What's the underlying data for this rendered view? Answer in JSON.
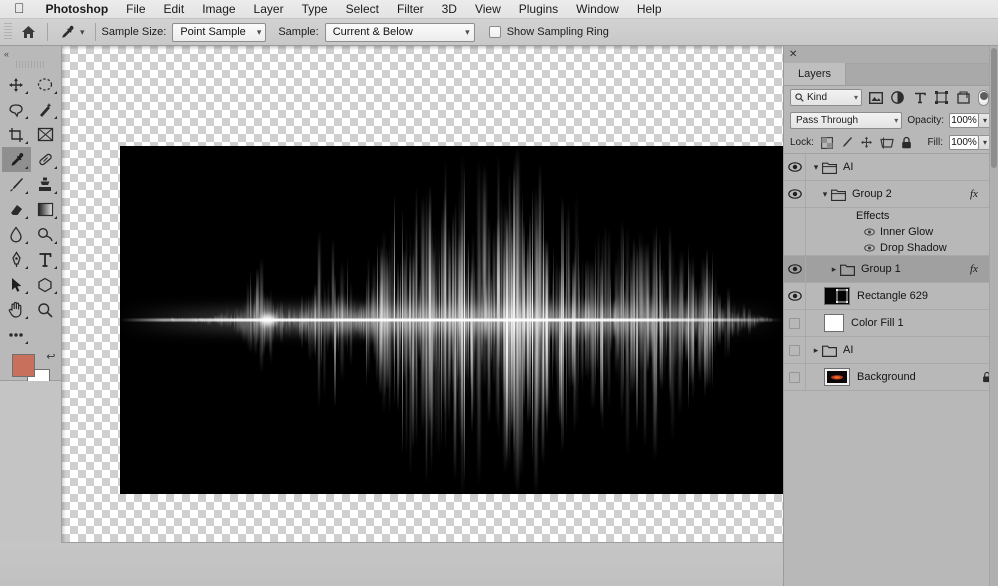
{
  "menubar": {
    "apple_icon": "apple-logo",
    "items": [
      {
        "label": "Photoshop",
        "bold": true
      },
      {
        "label": "File",
        "bold": false
      },
      {
        "label": "Edit",
        "bold": false
      },
      {
        "label": "Image",
        "bold": false
      },
      {
        "label": "Layer",
        "bold": false
      },
      {
        "label": "Type",
        "bold": false
      },
      {
        "label": "Select",
        "bold": false
      },
      {
        "label": "Filter",
        "bold": false
      },
      {
        "label": "3D",
        "bold": false
      },
      {
        "label": "View",
        "bold": false
      },
      {
        "label": "Plugins",
        "bold": false
      },
      {
        "label": "Window",
        "bold": false
      },
      {
        "label": "Help",
        "bold": false
      }
    ]
  },
  "options_bar": {
    "home_icon": "home-icon",
    "tool_icon": "eyedropper-icon",
    "tool_preset_chevron": "chevron-down-icon",
    "sample_size_label": "Sample Size:",
    "sample_size_value": "Point Sample",
    "sample_label": "Sample:",
    "sample_value": "Current & Below",
    "show_sampling_ring_label": "Show Sampling Ring",
    "show_sampling_ring_checked": false
  },
  "toolbar": {
    "collapse_icon": "double-chevron-left-icon",
    "tools": [
      {
        "name": "move-tool",
        "icon": "move-icon",
        "selected": false,
        "has_flyout": true
      },
      {
        "name": "elliptical-marquee-tool",
        "icon": "ellipse-dashed-icon",
        "selected": false,
        "has_flyout": true
      },
      {
        "name": "lasso-tool",
        "icon": "lasso-icon",
        "selected": false,
        "has_flyout": true
      },
      {
        "name": "magic-wand-tool",
        "icon": "magic-wand-icon",
        "selected": false,
        "has_flyout": true
      },
      {
        "name": "crop-tool",
        "icon": "crop-icon",
        "selected": false,
        "has_flyout": true
      },
      {
        "name": "frame-tool",
        "icon": "frame-icon",
        "selected": false,
        "has_flyout": false
      },
      {
        "name": "eyedropper-tool",
        "icon": "eyedropper-icon",
        "selected": true,
        "has_flyout": true
      },
      {
        "name": "healing-brush-tool",
        "icon": "bandage-icon",
        "selected": false,
        "has_flyout": true
      },
      {
        "name": "brush-tool",
        "icon": "brush-icon",
        "selected": false,
        "has_flyout": true
      },
      {
        "name": "clone-stamp-tool",
        "icon": "stamp-icon",
        "selected": false,
        "has_flyout": true
      },
      {
        "name": "eraser-tool",
        "icon": "eraser-icon",
        "selected": false,
        "has_flyout": true
      },
      {
        "name": "gradient-tool",
        "icon": "gradient-icon",
        "selected": false,
        "has_flyout": true
      },
      {
        "name": "blur-tool",
        "icon": "waterdrop-icon",
        "selected": false,
        "has_flyout": true
      },
      {
        "name": "dodge-tool",
        "icon": "dodge-icon",
        "selected": false,
        "has_flyout": true
      },
      {
        "name": "pen-tool",
        "icon": "pen-icon",
        "selected": false,
        "has_flyout": true
      },
      {
        "name": "type-tool",
        "icon": "type-t-icon",
        "selected": false,
        "has_flyout": true
      },
      {
        "name": "path-selection-tool",
        "icon": "arrow-pointer-icon",
        "selected": false,
        "has_flyout": true
      },
      {
        "name": "polygon-tool",
        "icon": "polygon-icon",
        "selected": false,
        "has_flyout": true
      },
      {
        "name": "hand-tool",
        "icon": "hand-icon",
        "selected": false,
        "has_flyout": true
      },
      {
        "name": "zoom-tool",
        "icon": "magnifier-icon",
        "selected": false,
        "has_flyout": false
      },
      {
        "name": "edit-toolbar-tool",
        "icon": "ellipsis-icon",
        "selected": false,
        "has_flyout": true
      }
    ],
    "foreground_color": "#c9705c",
    "background_color": "#ffffff",
    "swap_colors_icon": "swap-arrows-icon",
    "default_colors_icon": "default-colors-icon",
    "quick_mask_icon": "quick-mask-icon",
    "screen_mode_icon": "screen-mode-icon"
  },
  "canvas": {
    "artwork_name": "audio-waveform-light-streaks",
    "artwork_background": "#000000",
    "artwork_accent": "#ffffff"
  },
  "layers_panel": {
    "close_icon": "close-icon",
    "tab_label": "Layers",
    "filter": {
      "search_icon": "search-icon",
      "kind_label": "Kind",
      "chevron_icon": "chevron-down-icon",
      "filter_icons": [
        {
          "name": "filter-pixel-icon",
          "label": "pixel-layers-filter"
        },
        {
          "name": "filter-adjustment-icon",
          "label": "adjustment-layers-filter"
        },
        {
          "name": "filter-type-icon",
          "label": "type-layers-filter"
        },
        {
          "name": "filter-shape-icon",
          "label": "shape-layers-filter"
        },
        {
          "name": "filter-smartobject-icon",
          "label": "smart-object-filter"
        }
      ],
      "toggle_name": "filter-enable-toggle"
    },
    "blend_mode": "Pass Through",
    "opacity_label": "Opacity:",
    "opacity_value": "100%",
    "lock_label": "Lock:",
    "lock_icons": [
      {
        "name": "lock-transparent-pixels-icon"
      },
      {
        "name": "lock-image-pixels-icon"
      },
      {
        "name": "lock-position-icon"
      },
      {
        "name": "lock-artboard-nesting-icon"
      },
      {
        "name": "lock-all-icon"
      }
    ],
    "fill_label": "Fill:",
    "fill_value": "100%",
    "layers": [
      {
        "name": "AI",
        "type": "group",
        "visible": true,
        "expanded": true,
        "indent": 0,
        "has_fx": false,
        "locked": false,
        "selected": false,
        "thumb": "folder"
      },
      {
        "name": "Group 2",
        "type": "group",
        "visible": true,
        "expanded": true,
        "indent": 1,
        "has_fx": true,
        "fx_expanded": true,
        "locked": false,
        "selected": false,
        "thumb": "folder"
      },
      {
        "name": "Group 1",
        "type": "group",
        "visible": true,
        "expanded": false,
        "indent": 1,
        "has_fx": true,
        "fx_expanded": false,
        "locked": false,
        "selected": true,
        "thumb": "folder"
      },
      {
        "name": "Rectangle 629",
        "type": "shape",
        "visible": true,
        "indent": 0,
        "has_fx": false,
        "locked": false,
        "selected": false,
        "thumb": "black-with-vector-mask"
      },
      {
        "name": "Color Fill 1",
        "type": "fill",
        "visible": false,
        "indent": 0,
        "has_fx": false,
        "locked": false,
        "selected": false,
        "thumb": "white"
      },
      {
        "name": "AI",
        "type": "group",
        "visible": false,
        "expanded": false,
        "indent": 0,
        "has_fx": false,
        "locked": false,
        "selected": false,
        "thumb": "folder"
      },
      {
        "name": "Background",
        "type": "image",
        "visible": false,
        "indent": 0,
        "has_fx": false,
        "locked": true,
        "selected": false,
        "thumb": "dark-red-photo"
      }
    ],
    "effects": {
      "group_label": "Effects",
      "items": [
        {
          "label": "Inner Glow",
          "visible": true,
          "icon": "eye-icon"
        },
        {
          "label": "Drop Shadow",
          "visible": true,
          "icon": "eye-icon"
        }
      ]
    }
  }
}
